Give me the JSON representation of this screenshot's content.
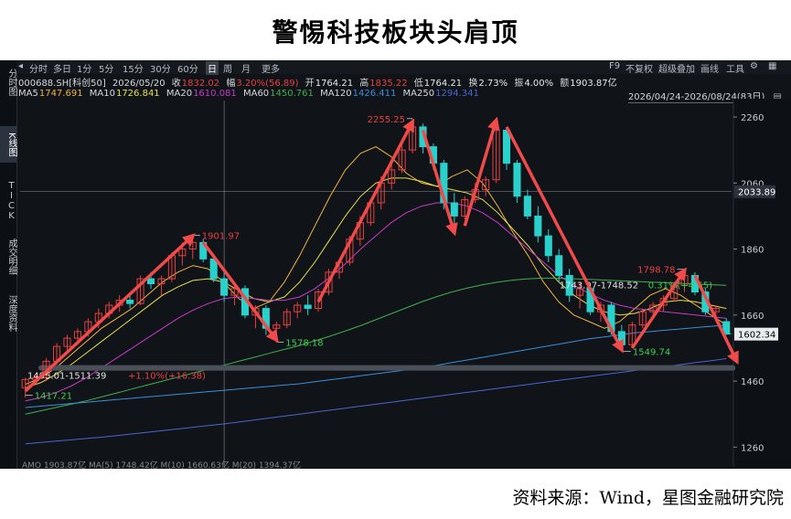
{
  "title": "警惕科技板块头肩顶",
  "source": "资料来源：Wind，星图金融研究院",
  "left_tabs": [
    {
      "label": "分时图",
      "active": false
    },
    {
      "label": "K线图",
      "active": true
    },
    {
      "label": "TICK",
      "active": false
    },
    {
      "label": "成交明细",
      "active": false
    },
    {
      "label": "深度资料",
      "active": false
    }
  ],
  "toolbar": {
    "periods": [
      "分时",
      "多日",
      "1分",
      "5分",
      "15分",
      "30分",
      "60分",
      "日",
      "周",
      "月",
      "更多"
    ],
    "active_period": "日",
    "right_items": [
      "F9",
      "不复权",
      "超级叠加",
      "画线",
      "工具"
    ]
  },
  "quote": {
    "code": "000688.SH[科创50]",
    "date": "2026/05/20",
    "close_label": "收",
    "close": "1832.02",
    "change_label": "幅",
    "change": "3.20%(56.89)",
    "open_label": "开",
    "open": "1764.21",
    "high_label": "高",
    "high": "1835.22",
    "low_label": "低",
    "low": "1764.21",
    "turnover_label": "换",
    "turnover": "2.73%",
    "amplitude_label": "振",
    "amplitude": "4.00%",
    "amount_label": "额",
    "amount": "1903.87亿"
  },
  "ma_row": [
    {
      "name": "MA5",
      "value": "1747.691",
      "color": "#f2b53c"
    },
    {
      "name": "MA10",
      "value": "1726.841",
      "color": "#e8e04a"
    },
    {
      "name": "MA20",
      "value": "1610.081",
      "color": "#c43cc4"
    },
    {
      "name": "MA60",
      "value": "1450.761",
      "color": "#3fb04f"
    },
    {
      "name": "MA120",
      "value": "1426.411",
      "color": "#3a8fd9"
    },
    {
      "name": "MA250",
      "value": "1294.341",
      "color": "#4a66d0"
    }
  ],
  "date_range": "2026/04/24-2026/08/24(83日)",
  "price_axis": {
    "ticks": [
      "2260",
      "2060",
      "1860",
      "1660",
      "1460",
      "1260"
    ],
    "crosshair_value": "2033.89",
    "last_value": "1602.34"
  },
  "annotations": {
    "low_start": "1417.21",
    "left_shoulder": "1901.97",
    "left_trough": "1578.18",
    "head": "2255.25",
    "right_trough": "1549.74",
    "right_shoulder": "1798.78",
    "range_note": "1743.97-1748.52",
    "range_pct": "0.31%(+4.55)",
    "support_note": "1495.01-1511.39",
    "support_pct": "+1.10%(+16.38)"
  },
  "bottom_strip": "AMO 1903.87亿  MA(5) 1748.42亿  M(10) 1660.63亿  M(20) 1394.37亿",
  "colors": {
    "up": "#e8413e",
    "down": "#2ad1cc",
    "arrow": "#f04a4a",
    "neckline": "#4a4f58",
    "bg": "#101318"
  },
  "chart_data": {
    "type": "candlestick",
    "y_range": [
      1200,
      2310
    ],
    "candles": [
      [
        1440,
        1470,
        1410,
        1465
      ],
      [
        1465,
        1480,
        1450,
        1470
      ],
      [
        1470,
        1530,
        1460,
        1520
      ],
      [
        1520,
        1575,
        1510,
        1565
      ],
      [
        1565,
        1600,
        1545,
        1590
      ],
      [
        1590,
        1620,
        1570,
        1610
      ],
      [
        1610,
        1650,
        1595,
        1640
      ],
      [
        1640,
        1680,
        1620,
        1665
      ],
      [
        1665,
        1700,
        1650,
        1690
      ],
      [
        1690,
        1720,
        1670,
        1705
      ],
      [
        1705,
        1720,
        1680,
        1695
      ],
      [
        1695,
        1780,
        1690,
        1770
      ],
      [
        1770,
        1790,
        1740,
        1755
      ],
      [
        1755,
        1780,
        1720,
        1770
      ],
      [
        1770,
        1850,
        1760,
        1840
      ],
      [
        1840,
        1880,
        1810,
        1860
      ],
      [
        1860,
        1901.97,
        1830,
        1880
      ],
      [
        1880,
        1890,
        1820,
        1830
      ],
      [
        1830,
        1840,
        1760,
        1770
      ],
      [
        1770,
        1790,
        1700,
        1720
      ],
      [
        1720,
        1760,
        1690,
        1740
      ],
      [
        1740,
        1750,
        1650,
        1660
      ],
      [
        1660,
        1690,
        1620,
        1680
      ],
      [
        1680,
        1690,
        1600,
        1620
      ],
      [
        1620,
        1640,
        1578.18,
        1630
      ],
      [
        1630,
        1680,
        1620,
        1670
      ],
      [
        1670,
        1700,
        1650,
        1690
      ],
      [
        1690,
        1720,
        1660,
        1680
      ],
      [
        1680,
        1740,
        1670,
        1730
      ],
      [
        1730,
        1800,
        1720,
        1790
      ],
      [
        1790,
        1830,
        1770,
        1820
      ],
      [
        1820,
        1900,
        1810,
        1890
      ],
      [
        1890,
        1960,
        1870,
        1940
      ],
      [
        1940,
        2010,
        1930,
        2000
      ],
      [
        2000,
        2080,
        1980,
        2060
      ],
      [
        2060,
        2120,
        2040,
        2100
      ],
      [
        2100,
        2180,
        2090,
        2160
      ],
      [
        2160,
        2255.25,
        2150,
        2230
      ],
      [
        2230,
        2240,
        2150,
        2170
      ],
      [
        2170,
        2180,
        2100,
        2120
      ],
      [
        2120,
        2130,
        1980,
        2000
      ],
      [
        2000,
        2030,
        1930,
        1960
      ],
      [
        1960,
        2020,
        1950,
        2010
      ],
      [
        2010,
        2060,
        2000,
        2040
      ],
      [
        2040,
        2080,
        2020,
        2070
      ],
      [
        2070,
        2240,
        2060,
        2220
      ],
      [
        2220,
        2230,
        2100,
        2120
      ],
      [
        2120,
        2130,
        2000,
        2020
      ],
      [
        2020,
        2040,
        1950,
        1960
      ],
      [
        1960,
        1990,
        1880,
        1900
      ],
      [
        1900,
        1920,
        1820,
        1840
      ],
      [
        1840,
        1860,
        1760,
        1780
      ],
      [
        1780,
        1800,
        1700,
        1720
      ],
      [
        1720,
        1760,
        1680,
        1740
      ],
      [
        1740,
        1750,
        1660,
        1670
      ],
      [
        1670,
        1700,
        1640,
        1690
      ],
      [
        1690,
        1700,
        1600,
        1610
      ],
      [
        1610,
        1630,
        1549.74,
        1570
      ],
      [
        1570,
        1640,
        1560,
        1630
      ],
      [
        1630,
        1680,
        1620,
        1670
      ],
      [
        1670,
        1700,
        1650,
        1690
      ],
      [
        1690,
        1720,
        1670,
        1710
      ],
      [
        1710,
        1760,
        1700,
        1750
      ],
      [
        1750,
        1798.78,
        1730,
        1780
      ],
      [
        1780,
        1790,
        1720,
        1730
      ],
      [
        1730,
        1740,
        1660,
        1670
      ],
      [
        1670,
        1690,
        1640,
        1680
      ],
      [
        1640,
        1650,
        1600,
        1602.34
      ]
    ],
    "ma_lines": [
      {
        "name": "MA5",
        "color": "#f2b53c",
        "values": [
          1450,
          1470,
          1500,
          1540,
          1580,
          1620,
          1650,
          1680,
          1720,
          1760,
          1790,
          1810,
          1800,
          1760,
          1710,
          1680,
          1700,
          1760,
          1840,
          1930,
          2020,
          2100,
          2150,
          2170,
          2140,
          2090,
          2060,
          2050,
          2080,
          2100,
          2060,
          1990,
          1910,
          1840,
          1760,
          1700,
          1660,
          1640,
          1620,
          1640,
          1680,
          1720,
          1740,
          1720,
          1690,
          1660,
          1630
        ]
      },
      {
        "name": "MA10",
        "color": "#e8e04a",
        "values": [
          1440,
          1455,
          1480,
          1510,
          1545,
          1580,
          1615,
          1650,
          1685,
          1720,
          1745,
          1765,
          1770,
          1760,
          1735,
          1710,
          1700,
          1715,
          1760,
          1820,
          1890,
          1960,
          2020,
          2060,
          2075,
          2075,
          2065,
          2050,
          2040,
          2030,
          2010,
          1970,
          1920,
          1870,
          1810,
          1760,
          1720,
          1690,
          1670,
          1660,
          1665,
          1680,
          1700,
          1705,
          1700,
          1690,
          1680
        ]
      },
      {
        "name": "MA20",
        "color": "#c43cc4",
        "values": [
          1400,
          1410,
          1425,
          1445,
          1470,
          1500,
          1530,
          1560,
          1590,
          1620,
          1650,
          1675,
          1695,
          1710,
          1715,
          1710,
          1705,
          1705,
          1715,
          1740,
          1775,
          1815,
          1860,
          1900,
          1940,
          1970,
          1990,
          2000,
          2000,
          1990,
          1970,
          1940,
          1900,
          1860,
          1820,
          1780,
          1750,
          1725,
          1705,
          1690,
          1680,
          1675,
          1670,
          1665,
          1660,
          1655,
          1650
        ]
      },
      {
        "name": "MA60",
        "color": "#3fb04f",
        "values": [
          1360,
          1370,
          1380,
          1390,
          1400,
          1412,
          1424,
          1436,
          1448,
          1460,
          1472,
          1484,
          1496,
          1508,
          1520,
          1532,
          1544,
          1556,
          1568,
          1582,
          1596,
          1612,
          1628,
          1646,
          1664,
          1682,
          1700,
          1716,
          1730,
          1742,
          1752,
          1760,
          1766,
          1770,
          1772,
          1772,
          1770,
          1768,
          1766,
          1764,
          1762,
          1760,
          1758,
          1756,
          1754,
          1752,
          1750
        ]
      },
      {
        "name": "MA120",
        "color": "#3a8fd9",
        "values": [
          1380,
          1384,
          1388,
          1392,
          1396,
          1400,
          1404,
          1408,
          1412,
          1416,
          1420,
          1424,
          1428,
          1432,
          1436,
          1440,
          1444,
          1448,
          1452,
          1458,
          1464,
          1470,
          1476,
          1482,
          1488,
          1494,
          1500,
          1508,
          1516,
          1524,
          1532,
          1540,
          1548,
          1556,
          1564,
          1572,
          1580,
          1588,
          1594,
          1600,
          1606,
          1610,
          1614,
          1618,
          1622,
          1626,
          1630
        ]
      },
      {
        "name": "MA250",
        "color": "#4a66d0",
        "values": [
          1270,
          1274,
          1278,
          1282,
          1286,
          1290,
          1295,
          1300,
          1305,
          1310,
          1315,
          1320,
          1325,
          1330,
          1336,
          1342,
          1348,
          1354,
          1360,
          1366,
          1372,
          1378,
          1384,
          1390,
          1396,
          1402,
          1408,
          1414,
          1420,
          1426,
          1432,
          1438,
          1444,
          1450,
          1456,
          1462,
          1468,
          1474,
          1480,
          1486,
          1492,
          1498,
          1504,
          1510,
          1516,
          1522,
          1528
        ]
      }
    ],
    "arrows": [
      {
        "from": [
          0,
          1430
        ],
        "to": [
          16,
          1900
        ]
      },
      {
        "from": [
          17,
          1880
        ],
        "to": [
          24,
          1585
        ]
      },
      {
        "from": [
          28,
          1700
        ],
        "to": [
          37,
          2245
        ]
      },
      {
        "from": [
          38,
          2220
        ],
        "to": [
          41,
          1910
        ]
      },
      {
        "from": [
          42,
          1930
        ],
        "to": [
          45,
          2250
        ]
      },
      {
        "from": [
          46,
          2230
        ],
        "to": [
          57,
          1555
        ]
      },
      {
        "from": [
          58,
          1560
        ],
        "to": [
          63,
          1795
        ]
      },
      {
        "from": [
          64,
          1780
        ],
        "to": [
          68,
          1520
        ]
      }
    ],
    "neckline": [
      1500,
      1500
    ]
  }
}
